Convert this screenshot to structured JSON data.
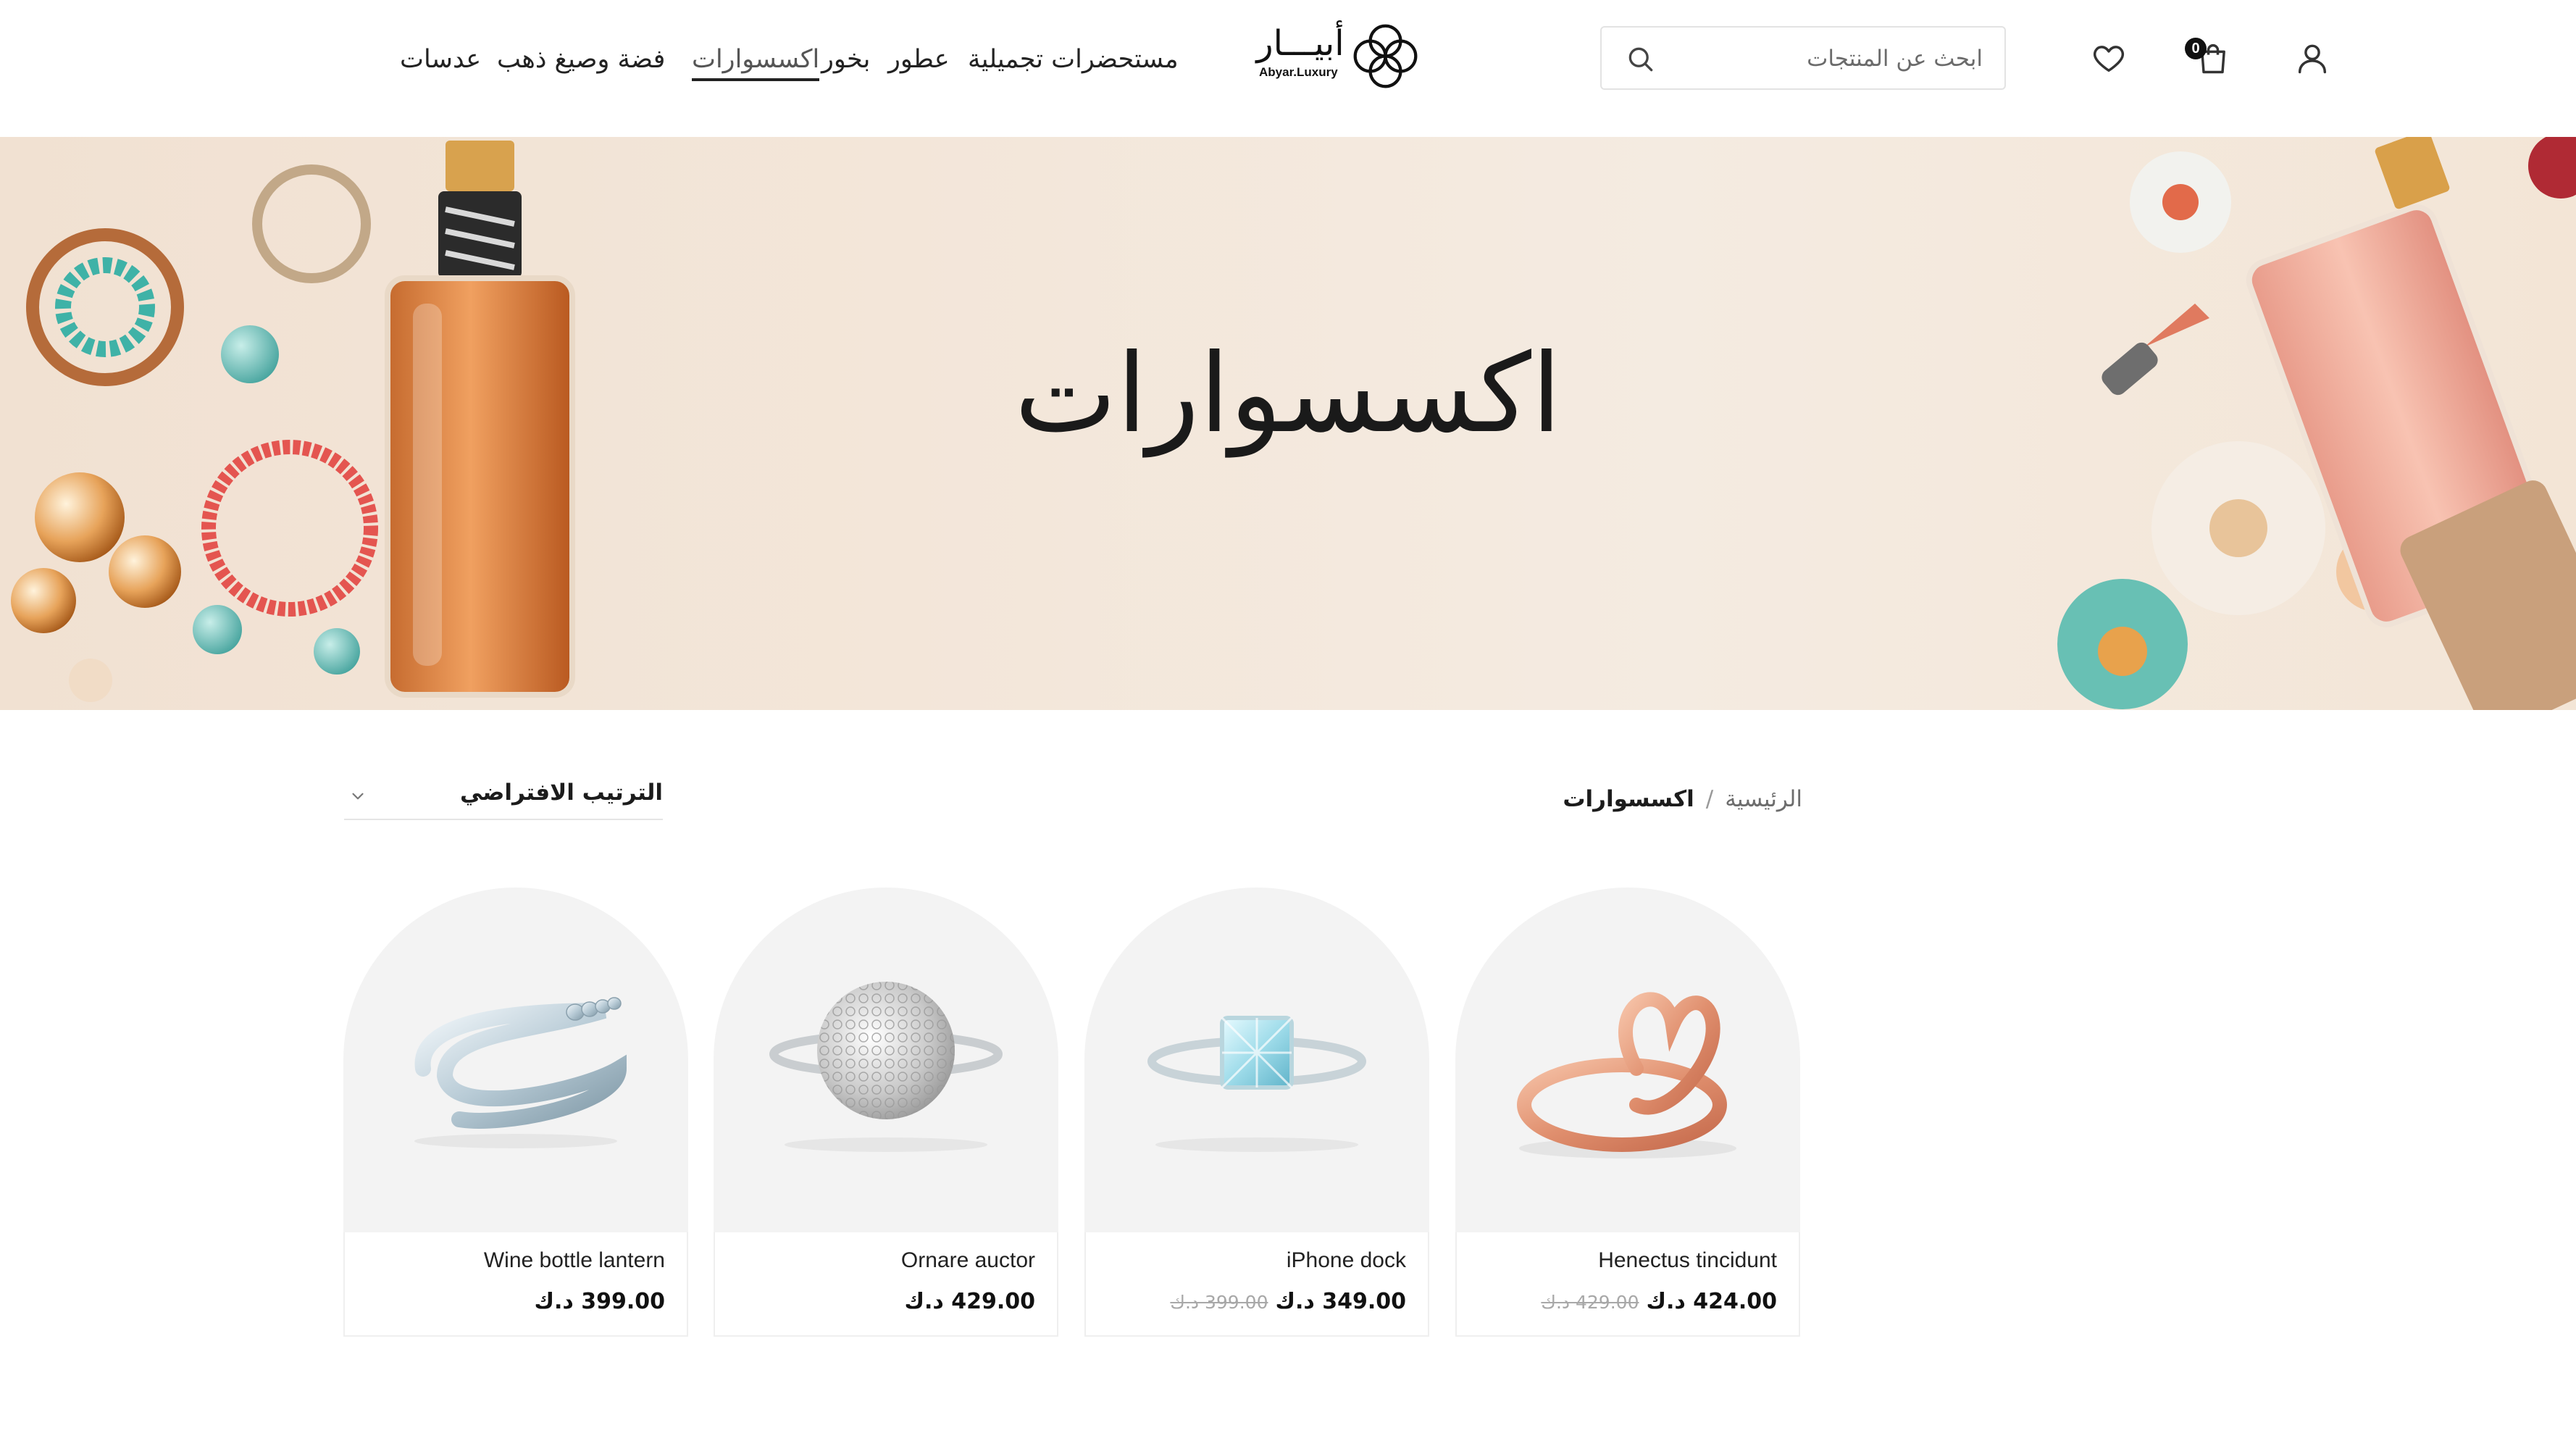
{
  "header": {
    "nav": [
      {
        "label": "مستحضرات تجميلية"
      },
      {
        "label": "عطور"
      },
      {
        "label": "بخور"
      },
      {
        "label": "اكسسوارات",
        "active": true
      },
      {
        "label": "فضة وصيغ ذهب"
      },
      {
        "label": "عدسات"
      }
    ],
    "logo": {
      "arabic": "أبيـــار",
      "latin": "Abyar.Luxury"
    },
    "search": {
      "placeholder": "ابحث عن المنتجات",
      "value": ""
    },
    "cart_count": "0",
    "icons": [
      "search-icon",
      "heart-icon",
      "shopping-bag-icon",
      "user-icon"
    ]
  },
  "hero": {
    "title": "اكسسوارات"
  },
  "breadcrumb": {
    "home": "الرئيسية",
    "separator": "/",
    "current": "اكسسوارات"
  },
  "sort": {
    "selected": "الترتيب الافتراضي"
  },
  "products": [
    {
      "name": "Henectus tincidunt",
      "price": "424.00 د.ك",
      "old_price": "429.00 د.ك",
      "image": "rose-gold-heart-ring"
    },
    {
      "name": "iPhone dock",
      "price": "349.00 د.ك",
      "old_price": "399.00 د.ك",
      "image": "square-diamond-ring"
    },
    {
      "name": "Ornare auctor",
      "price": "429.00 د.ك",
      "old_price": "",
      "image": "pave-dome-ring"
    },
    {
      "name": "Wine bottle lantern",
      "price": "399.00 د.ك",
      "old_price": "",
      "image": "silver-wrap-ring"
    }
  ],
  "colors": {
    "accent": "#1c1c1c",
    "hero_bg": "#f3e6d9",
    "card_bg": "#f3f3f3",
    "old_price": "#a8a8a8"
  }
}
